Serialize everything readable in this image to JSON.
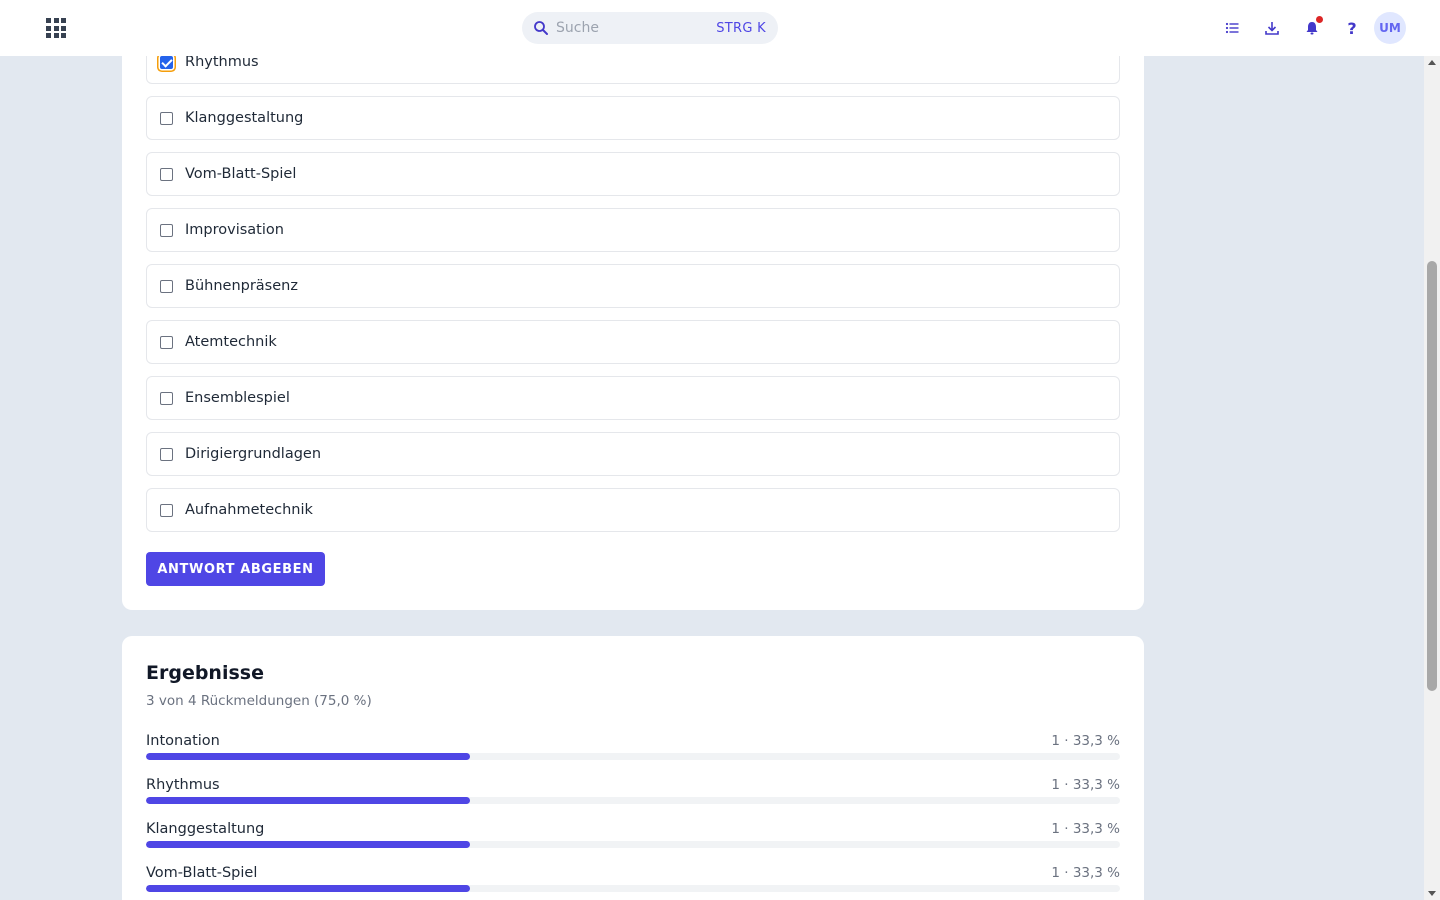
{
  "header": {
    "search": {
      "placeholder": "Suche",
      "shortcut": "STRG K"
    },
    "icons": [
      "apps-grid-icon",
      "list-icon",
      "download-icon",
      "bell-icon",
      "help-icon"
    ],
    "help_label": "?",
    "avatar_initials": "UM",
    "has_notification": true
  },
  "question": {
    "options": [
      {
        "label": "Rhythmus",
        "checked": true
      },
      {
        "label": "Klanggestaltung",
        "checked": false
      },
      {
        "label": "Vom-Blatt-Spiel",
        "checked": false
      },
      {
        "label": "Improvisation",
        "checked": false
      },
      {
        "label": "Bühnenpräsenz",
        "checked": false
      },
      {
        "label": "Atemtechnik",
        "checked": false
      },
      {
        "label": "Ensemblespiel",
        "checked": false
      },
      {
        "label": "Dirigiergrundlagen",
        "checked": false
      },
      {
        "label": "Aufnahmetechnik",
        "checked": false
      }
    ],
    "submit_label": "ANTWORT ABGEBEN"
  },
  "results": {
    "title": "Ergebnisse",
    "subtitle": "3 von 4 Rückmeldungen (75,0 %)",
    "rows": [
      {
        "label": "Intonation",
        "value_text": "1 · 33,3 %",
        "percent": 33.3
      },
      {
        "label": "Rhythmus",
        "value_text": "1 · 33,3 %",
        "percent": 33.3
      },
      {
        "label": "Klanggestaltung",
        "value_text": "1 · 33,3 %",
        "percent": 33.3
      },
      {
        "label": "Vom-Blatt-Spiel",
        "value_text": "1 · 33,3 %",
        "percent": 33.3
      }
    ]
  },
  "colors": {
    "accent": "#4f46e5",
    "background": "#e2e8f0",
    "notification": "#dc2626",
    "focus_ring": "#f59e0b"
  }
}
